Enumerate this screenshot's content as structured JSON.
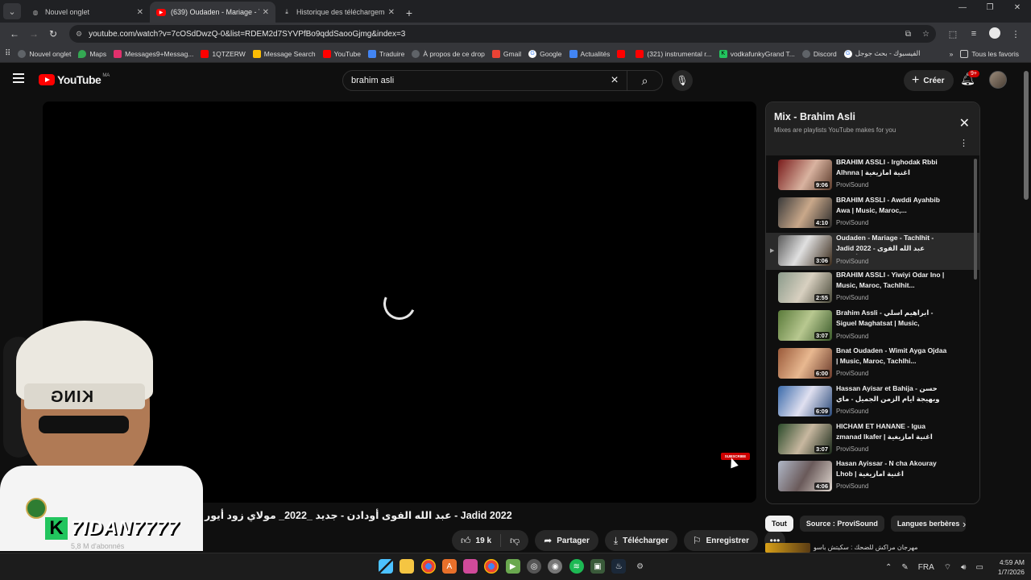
{
  "browser": {
    "tabs": [
      {
        "label": "Nouvel onglet",
        "active": false,
        "icon": "globe-icon"
      },
      {
        "label": "(639) Oudaden - Mariage - Tachlhit",
        "active": true,
        "icon": "youtube-icon"
      },
      {
        "label": "Historique des téléchargements",
        "active": false,
        "icon": "download-icon"
      }
    ],
    "url": "youtube.com/watch?v=7cOSdDwzQ-0&list=RDEM2d7SYVPfBo9qddSaooGjmg&index=3",
    "bookmarks": [
      {
        "label": "Nouvel onglet",
        "color": "#9aa0a6"
      },
      {
        "label": "Maps",
        "color": "#34a853"
      },
      {
        "label": "Messages9+Messag...",
        "color": "#e1306c"
      },
      {
        "label": "1QTZERW",
        "color": "#ff0000"
      },
      {
        "label": "Message Search",
        "color": "#fbbc04"
      },
      {
        "label": "YouTube",
        "color": "#ff0000"
      },
      {
        "label": "Traduire",
        "color": "#4285f4"
      },
      {
        "label": "À propos de ce drop",
        "color": "#9aa0a6"
      },
      {
        "label": "Gmail",
        "color": "#ea4335"
      },
      {
        "label": "Google",
        "color": "#4285f4"
      },
      {
        "label": "Actualités",
        "color": "#4285f4"
      },
      {
        "label": "",
        "color": "#ff0000"
      },
      {
        "label": "(321) instrumental r...",
        "color": "#ff0000"
      },
      {
        "label": "vodkafunkyGrand T...",
        "color": "#22c55e"
      },
      {
        "label": "Discord",
        "color": "#9aa0a6"
      },
      {
        "label": "الفيسبوك - بحث جوجل",
        "color": "#4285f4"
      }
    ],
    "bookmarks_all": "Tous les favoris"
  },
  "youtube": {
    "logo_text": "YouTube",
    "country_code": "MA",
    "search_query": "brahim asli",
    "create_label": "Créer",
    "notifications": "9+",
    "video_title": "عبد الله الفوى أودادن - جديد _2022_ مولاي زود أيور - Jadid 2022",
    "subscribers": "5,8 M d'abonnés",
    "likes": "19 k",
    "share_label": "Partager",
    "download_label": "Télécharger",
    "save_label": "Enregistrer",
    "subscribe_badge": "SUBSCRIBE"
  },
  "playlist": {
    "title": "Mix - Brahim Asli",
    "subtitle": "Mixes are playlists YouTube makes for you",
    "items": [
      {
        "title": "BRAHIM ASSLI - Irghodak Rbbi Alhnna | اغنية امازيغية",
        "channel": "ProviSound",
        "duration": "9:06",
        "current": false
      },
      {
        "title": "BRAHIM ASSLI - Awddi Ayahbib Awa | Music, Maroc,...",
        "channel": "ProviSound",
        "duration": "4:10",
        "current": false
      },
      {
        "title": "Oudaden - Mariage - Tachlhit - Jadid 2022 - عبد الله الفوى أودادن...",
        "channel": "ProviSound",
        "duration": "3:06",
        "current": true
      },
      {
        "title": "BRAHIM ASSLI - Yiwiyi Odar Ino | Music, Maroc, Tachlhit...",
        "channel": "ProviSound",
        "duration": "2:55",
        "current": false
      },
      {
        "title": "Brahim Assli - ابراهيم اسلي - Siguel Maghatsat | Music, Tachlhit...",
        "channel": "ProviSound",
        "duration": "3:07",
        "current": false
      },
      {
        "title": "Bnat Oudaden - Wimit Ayga Ojdaa | Music, Maroc, Tachlhi...",
        "channel": "ProviSound",
        "duration": "6:00",
        "current": false
      },
      {
        "title": "Hassan Ayisar et Bahija - حسن وبهيجة ايام الزمن الجميل - ماي",
        "channel": "ProviSound",
        "duration": "6:09",
        "current": false
      },
      {
        "title": "HICHAM ET HANANE - Igua zmanad lkafer | اغنية امازيغية",
        "channel": "ProviSound",
        "duration": "3:07",
        "current": false
      },
      {
        "title": "Hasan Ayissar - N cha Akouray Lhob | اغنية امازيغية",
        "channel": "ProviSound",
        "duration": "4:06",
        "current": false
      }
    ],
    "chips": [
      "Tout",
      "Source : ProviSound",
      "Langues berbères"
    ],
    "next_row": "مهرجان مراكش للضحك : سكيتش باسو"
  },
  "overlay": {
    "cap_text": "KING",
    "brand_letter": "K",
    "brand_name": "7IDAN7777"
  },
  "taskbar": {
    "language": "FRA",
    "time": "4:59 AM",
    "date": "1/7/2026"
  }
}
